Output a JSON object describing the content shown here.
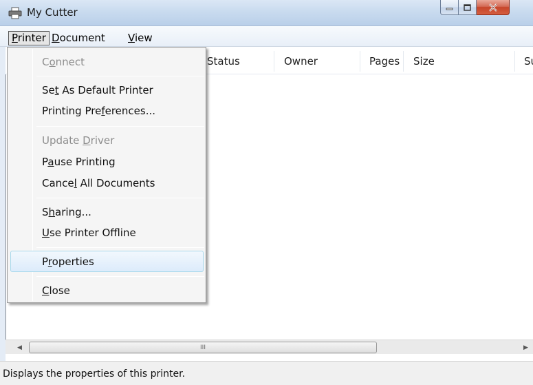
{
  "window": {
    "title": "My Cutter"
  },
  "menubar": {
    "printer": {
      "accel": "P",
      "rest": "rinter"
    },
    "document": {
      "accel": "D",
      "rest": "ocument"
    },
    "view": {
      "accel": "V",
      "rest": "iew"
    }
  },
  "columns": [
    "Status",
    "Owner",
    "Pages",
    "Size",
    "Sub"
  ],
  "printer_menu": {
    "connect": {
      "pre": "C",
      "accel": "o",
      "post": "nnect"
    },
    "set_default": {
      "pre": "Se",
      "accel": "t",
      "post": " As Default Printer"
    },
    "preferences": {
      "pre": "Printing Pre",
      "accel": "f",
      "post": "erences..."
    },
    "update_driver": {
      "pre": "Update ",
      "accel": "D",
      "post": "river"
    },
    "pause": {
      "pre": "P",
      "accel": "a",
      "post": "use Printing"
    },
    "cancel_all": {
      "pre": "Cance",
      "accel": "l",
      "post": " All Documents"
    },
    "sharing": {
      "pre": "S",
      "accel": "h",
      "post": "aring..."
    },
    "offline": {
      "pre": "",
      "accel": "U",
      "post": "se Printer Offline"
    },
    "properties": {
      "pre": "P",
      "accel": "r",
      "post": "operties"
    },
    "close": {
      "pre": "",
      "accel": "C",
      "post": "lose"
    }
  },
  "scrollbar": {
    "left": "◀",
    "right": "▶",
    "grip": "III"
  },
  "status": {
    "text": "Displays the properties of this printer."
  },
  "icons": {
    "app": "printer-icon",
    "minimize": "minimize-icon",
    "maximize": "maximize-icon",
    "close": "close-icon"
  },
  "colors": {
    "highlight_border": "#a8d8eb",
    "close_button": "#c6452a"
  }
}
